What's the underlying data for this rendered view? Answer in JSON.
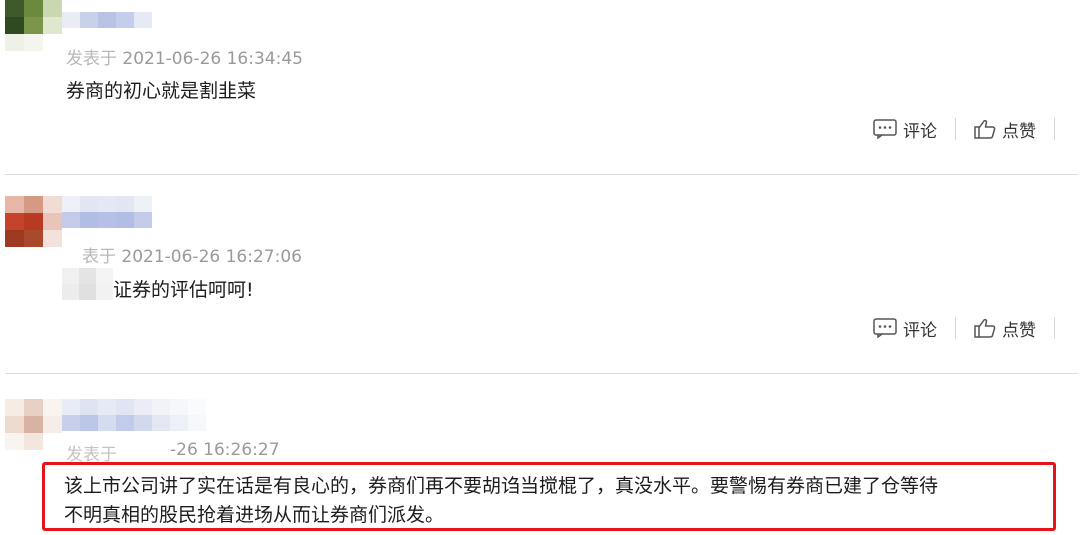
{
  "comments": [
    {
      "meta_prefix": "发表于",
      "timestamp": "2021-06-26 16:34:45",
      "text": "券商的初心就是割韭菜",
      "comment_label": "评论",
      "like_label": "点赞"
    },
    {
      "meta_prefix": "表于",
      "timestamp": "2021-06-26 16:27:06",
      "text": "证券的评估呵呵!",
      "comment_label": "评论",
      "like_label": "点赞"
    },
    {
      "meta_prefix": "发表于",
      "timestamp": "-26 16:26:27",
      "text_line1": "该上市公司讲了实在话是有良心的，券商们再不要胡诌当搅棍了，真没水平。要警惕有券商已建了仓等待",
      "text_line2": "不明真相的股民抢着进场从而让券商们派发。"
    }
  ],
  "colors": {
    "highlight": "#e5141b",
    "meta": "#9a9a9a"
  },
  "icons": [
    "comment-icon",
    "thumbs-up-icon"
  ]
}
